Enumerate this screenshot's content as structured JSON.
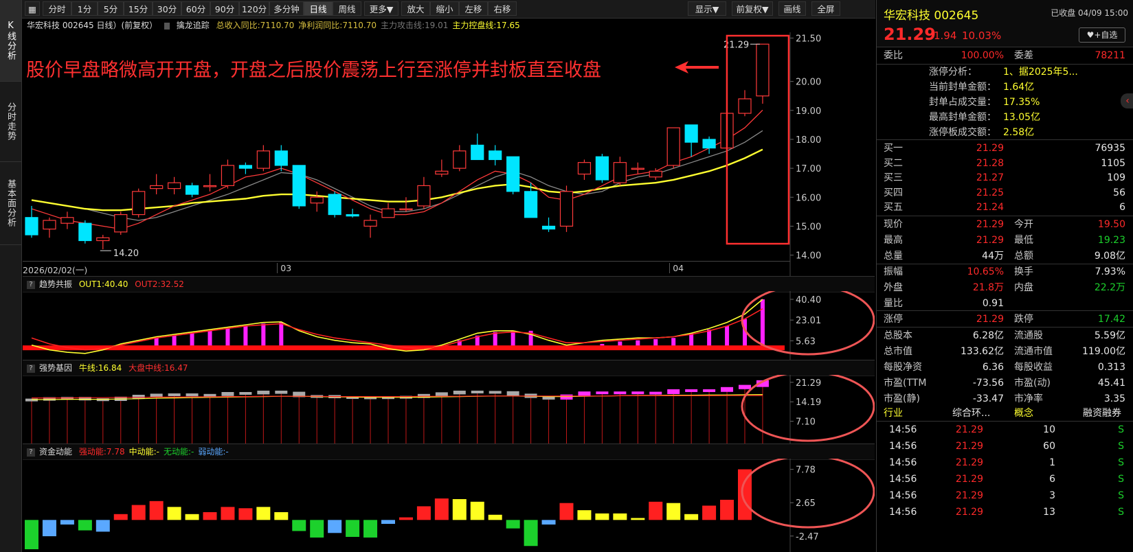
{
  "leftnav": [
    {
      "label": "K线分析",
      "active": true
    },
    {
      "label": "分时走势",
      "active": false
    },
    {
      "label": "基本面分析",
      "active": false
    }
  ],
  "toolbar": {
    "left": [
      "分时",
      "1分",
      "5分",
      "15分",
      "30分",
      "60分",
      "90分",
      "120分",
      "多分钟",
      "日线",
      "周线",
      "更多▼",
      "放大",
      "缩小",
      "左移",
      "右移"
    ],
    "active": "日线",
    "right": [
      "显示▼",
      "前复权▼",
      "画线",
      "全屏"
    ]
  },
  "main_header": {
    "title": "华宏科技 002645 日线）(前复权）",
    "indicator": "擒龙追踪",
    "items": [
      {
        "text": "总收入同比:7110.70",
        "color": "#d8c040"
      },
      {
        "text": "净利润同比:7110.70",
        "color": "#d8c040"
      },
      {
        "text": "主力攻击线:19.01",
        "color": "#777777"
      },
      {
        "text": "主力控盘线:17.65",
        "color": "#ffff30"
      }
    ]
  },
  "annotation": "股价早盘略微高开开盘，开盘之后股价震荡上行至涨停并封板直至收盘",
  "chart_data": [
    {
      "type": "candlestick",
      "title": "华宏科技 002645 日线",
      "ylim": [
        13.8,
        21.7
      ],
      "yticks": [
        "21.50",
        "20.00",
        "19.00",
        "18.00",
        "17.00",
        "16.00",
        "15.00",
        "14.00"
      ],
      "ytick_values": [
        21.5,
        20.0,
        19.0,
        18.0,
        17.0,
        16.0,
        15.0,
        14.0
      ],
      "xlabels": [
        {
          "i": 0,
          "label": "2026/02/02(一)"
        },
        {
          "i": 14,
          "label": "03"
        },
        {
          "i": 36,
          "label": "04"
        }
      ],
      "max_label": "21.29",
      "min_label": "14.20",
      "candles": [
        {
          "o": 15.3,
          "h": 15.7,
          "l": 14.6,
          "c": 14.7
        },
        {
          "o": 14.9,
          "h": 15.3,
          "l": 14.6,
          "c": 15.2
        },
        {
          "o": 15.1,
          "h": 15.5,
          "l": 14.9,
          "c": 15.3
        },
        {
          "o": 15.1,
          "h": 15.2,
          "l": 14.4,
          "c": 14.5
        },
        {
          "o": 14.5,
          "h": 14.7,
          "l": 14.2,
          "c": 14.6
        },
        {
          "o": 14.8,
          "h": 15.5,
          "l": 14.7,
          "c": 15.4
        },
        {
          "o": 15.4,
          "h": 16.3,
          "l": 15.3,
          "c": 16.2
        },
        {
          "o": 16.3,
          "h": 16.8,
          "l": 16.1,
          "c": 16.4
        },
        {
          "o": 16.3,
          "h": 16.7,
          "l": 16.1,
          "c": 16.5
        },
        {
          "o": 16.4,
          "h": 16.5,
          "l": 16.0,
          "c": 16.1
        },
        {
          "o": 16.4,
          "h": 16.8,
          "l": 16.2,
          "c": 16.4
        },
        {
          "o": 16.4,
          "h": 17.3,
          "l": 16.3,
          "c": 17.1
        },
        {
          "o": 17.1,
          "h": 17.2,
          "l": 16.8,
          "c": 17.0
        },
        {
          "o": 17.0,
          "h": 17.8,
          "l": 16.9,
          "c": 17.6
        },
        {
          "o": 17.6,
          "h": 17.8,
          "l": 16.9,
          "c": 17.1
        },
        {
          "o": 17.1,
          "h": 17.1,
          "l": 15.6,
          "c": 15.7
        },
        {
          "o": 15.8,
          "h": 16.2,
          "l": 15.5,
          "c": 16.0
        },
        {
          "o": 16.1,
          "h": 16.2,
          "l": 15.3,
          "c": 15.4
        },
        {
          "o": 15.4,
          "h": 15.6,
          "l": 15.3,
          "c": 15.35
        },
        {
          "o": 15.0,
          "h": 15.4,
          "l": 14.6,
          "c": 15.2
        },
        {
          "o": 15.3,
          "h": 15.8,
          "l": 15.3,
          "c": 15.6
        },
        {
          "o": 15.6,
          "h": 16.0,
          "l": 15.5,
          "c": 15.6
        },
        {
          "o": 15.7,
          "h": 16.7,
          "l": 15.6,
          "c": 16.4
        },
        {
          "o": 16.8,
          "h": 17.3,
          "l": 16.7,
          "c": 16.9
        },
        {
          "o": 17.0,
          "h": 17.8,
          "l": 16.9,
          "c": 17.6
        },
        {
          "o": 17.8,
          "h": 18.2,
          "l": 17.3,
          "c": 17.3
        },
        {
          "o": 17.6,
          "h": 17.8,
          "l": 17.1,
          "c": 17.3
        },
        {
          "o": 17.4,
          "h": 17.4,
          "l": 16.1,
          "c": 16.2
        },
        {
          "o": 16.2,
          "h": 16.5,
          "l": 15.3,
          "c": 15.3
        },
        {
          "o": 15.0,
          "h": 15.3,
          "l": 14.8,
          "c": 14.9
        },
        {
          "o": 15.0,
          "h": 16.4,
          "l": 14.8,
          "c": 16.2
        },
        {
          "o": 16.8,
          "h": 17.3,
          "l": 16.6,
          "c": 17.2
        },
        {
          "o": 17.4,
          "h": 17.5,
          "l": 16.5,
          "c": 16.6
        },
        {
          "o": 16.5,
          "h": 17.4,
          "l": 16.4,
          "c": 17.2
        },
        {
          "o": 17.0,
          "h": 17.2,
          "l": 16.8,
          "c": 17.0
        },
        {
          "o": 16.7,
          "h": 17.0,
          "l": 16.6,
          "c": 16.9
        },
        {
          "o": 17.1,
          "h": 18.4,
          "l": 17.0,
          "c": 18.4
        },
        {
          "o": 18.5,
          "h": 18.5,
          "l": 17.4,
          "c": 17.9
        },
        {
          "o": 18.0,
          "h": 18.1,
          "l": 17.5,
          "c": 17.7
        },
        {
          "o": 17.7,
          "h": 19.2,
          "l": 17.7,
          "c": 18.9
        },
        {
          "o": 18.9,
          "h": 19.7,
          "l": 18.8,
          "c": 19.4
        },
        {
          "o": 19.5,
          "h": 21.29,
          "l": 19.23,
          "c": 21.29
        }
      ],
      "series": [
        {
          "name": "主力攻击线",
          "color": "#ff3a3a",
          "values": [
            15.6,
            15.4,
            15.2,
            15.1,
            15.0,
            14.9,
            15.1,
            15.4,
            15.7,
            15.9,
            16.1,
            16.4,
            16.7,
            16.8,
            17.0,
            16.8,
            16.5,
            16.2,
            15.9,
            15.6,
            15.4,
            15.4,
            15.5,
            15.8,
            16.2,
            16.6,
            16.9,
            16.8,
            16.5,
            16.0,
            15.9,
            16.1,
            16.4,
            16.7,
            16.8,
            16.9,
            17.2,
            17.4,
            17.7,
            18.0,
            18.4,
            19.01
          ]
        },
        {
          "name": "主力控盘线",
          "color": "#ffff30",
          "values": [
            15.9,
            15.8,
            15.7,
            15.6,
            15.55,
            15.55,
            15.6,
            15.65,
            15.7,
            15.8,
            15.85,
            15.9,
            15.95,
            16.05,
            16.1,
            16.1,
            16.05,
            16.0,
            15.95,
            15.9,
            15.85,
            15.85,
            15.9,
            16.0,
            16.15,
            16.3,
            16.4,
            16.45,
            16.35,
            16.2,
            16.15,
            16.2,
            16.3,
            16.4,
            16.45,
            16.5,
            16.6,
            16.75,
            16.9,
            17.1,
            17.35,
            17.65
          ]
        },
        {
          "name": "",
          "color": "#8a8a8a",
          "values": [
            15.9,
            15.8,
            15.7,
            15.6,
            15.45,
            15.3,
            15.2,
            15.3,
            15.5,
            15.7,
            15.9,
            16.1,
            16.35,
            16.6,
            16.85,
            16.8,
            16.6,
            16.3,
            16.0,
            15.7,
            15.5,
            15.5,
            15.6,
            15.8,
            16.1,
            16.4,
            16.7,
            16.9,
            16.7,
            16.4,
            16.2,
            16.1,
            16.2,
            16.5,
            16.7,
            16.8,
            17.0,
            17.2,
            17.4,
            17.6,
            17.9,
            18.3
          ]
        }
      ]
    },
    {
      "type": "bar",
      "title": "趋势共振",
      "header": [
        "OUT1:40.40",
        "OUT2:32.52"
      ],
      "yticks": [
        "40.40",
        "23.01",
        "5.63"
      ],
      "ylim": [
        -8,
        45
      ],
      "values": [
        0,
        0,
        0,
        0,
        0,
        0,
        0,
        8,
        10,
        12,
        14,
        16,
        18,
        20,
        21,
        0,
        0,
        0,
        0,
        0,
        0,
        0,
        0,
        0,
        6,
        10,
        13,
        14,
        14,
        0,
        0,
        0,
        3,
        5,
        6,
        7,
        8,
        12,
        15,
        18,
        24,
        40.4
      ],
      "series": [
        {
          "name": "OUT1",
          "color": "#ffff30",
          "values": [
            2,
            -2,
            -4,
            -5,
            -2,
            3,
            6,
            9,
            11,
            13,
            15,
            17,
            19,
            21,
            21.5,
            14,
            9,
            6,
            4,
            3,
            -1,
            -3,
            -2,
            2,
            7,
            12,
            14,
            14,
            11,
            6,
            2,
            4,
            6,
            7,
            8,
            8,
            9,
            12,
            16,
            21,
            28,
            40.4
          ]
        },
        {
          "name": "OUT2",
          "color": "#ff2222",
          "values": [
            8,
            3,
            0,
            -2,
            -1,
            2,
            5,
            8,
            10,
            12,
            14,
            16,
            18,
            19,
            20,
            15,
            11,
            8,
            6,
            4,
            2,
            0,
            -1,
            1,
            5,
            9,
            12,
            13,
            12,
            8,
            4,
            4,
            5,
            6,
            7,
            8,
            9,
            11,
            14,
            18,
            24,
            32.52
          ]
        }
      ]
    },
    {
      "type": "bar",
      "title": "强势基因",
      "header": [
        "牛线:16.84",
        "大盘中线:16.47"
      ],
      "yticks": [
        "21.29",
        "14.19",
        "7.10"
      ],
      "ylim": [
        0,
        23
      ],
      "values": [
        14.6,
        15.1,
        15.2,
        14.7,
        14.5,
        15.3,
        16.0,
        16.4,
        16.5,
        16.2,
        16.3,
        17.0,
        16.9,
        17.5,
        17.1,
        15.9,
        15.9,
        15.5,
        15.4,
        15.2,
        15.5,
        15.6,
        16.3,
        16.9,
        17.5,
        17.4,
        17.3,
        16.4,
        15.6,
        15.0,
        16.1,
        17.2,
        17.0,
        17.2,
        17.1,
        17.0,
        18.0,
        18.0,
        17.8,
        18.8,
        19.6,
        21.29
      ],
      "series": [
        {
          "name": "牛线",
          "color": "#ffff30",
          "values": [
            15.0,
            15.0,
            15.1,
            15.1,
            15.1,
            15.2,
            15.3,
            15.5,
            15.6,
            15.7,
            15.8,
            15.9,
            16.0,
            16.1,
            16.2,
            16.2,
            16.1,
            16.0,
            15.9,
            15.8,
            15.8,
            15.8,
            15.9,
            16.0,
            16.1,
            16.2,
            16.3,
            16.3,
            16.2,
            16.1,
            16.1,
            16.2,
            16.3,
            16.4,
            16.5,
            16.5,
            16.6,
            16.6,
            16.7,
            16.7,
            16.8,
            16.84
          ]
        },
        {
          "name": "大盘中线",
          "color": "#ff2222",
          "values": [
            15.6,
            15.6,
            15.6,
            15.7,
            15.7,
            15.8,
            15.8,
            15.9,
            15.9,
            16.0,
            16.0,
            16.1,
            16.1,
            16.2,
            16.2,
            16.2,
            16.2,
            16.1,
            16.1,
            16.1,
            16.1,
            16.1,
            16.2,
            16.2,
            16.2,
            16.3,
            16.3,
            16.3,
            16.3,
            16.3,
            16.3,
            16.3,
            16.3,
            16.4,
            16.4,
            16.4,
            16.4,
            16.4,
            16.4,
            16.45,
            16.45,
            16.47
          ]
        }
      ]
    },
    {
      "type": "bar",
      "title": "资金动能",
      "header": [
        {
          "text": "强动能:7.78",
          "color": "#ff2a2a"
        },
        {
          "text": "中动能:-",
          "color": "#ffff30"
        },
        {
          "text": "无动能:-",
          "color": "#1cd12c"
        },
        {
          "text": "弱动能:-",
          "color": "#5aa8ff"
        }
      ],
      "yticks": [
        "7.78",
        "2.65",
        "-2.47"
      ],
      "ylim": [
        -4.5,
        9
      ],
      "values": [
        -4.5,
        -2.5,
        -0.7,
        -1.6,
        -1.8,
        0.9,
        2.3,
        2.9,
        2.0,
        0.9,
        1.2,
        2.0,
        1.8,
        2.0,
        1.2,
        -1.7,
        -2.7,
        -2.0,
        -2.6,
        -2.7,
        -0.6,
        0.4,
        2.1,
        3.3,
        3.2,
        2.8,
        0.8,
        -1.3,
        -4.0,
        -0.7,
        2.6,
        1.5,
        1.0,
        1.0,
        0.3,
        2.8,
        2.6,
        0.9,
        2.2,
        3.1,
        7.78
      ],
      "colors": [
        "#1cd12c",
        "#5aa8ff",
        "#5aa8ff",
        "#1cd12c",
        "#5aa8ff",
        "#ff2020",
        "#ff2020",
        "#ff2020",
        "#ffff20",
        "#ffff20",
        "#ff2020",
        "#ff2020",
        "#ff2020",
        "#ffff20",
        "#ffff20",
        "#1cd12c",
        "#1cd12c",
        "#5aa8ff",
        "#1cd12c",
        "#1cd12c",
        "#5aa8ff",
        "#ff2020",
        "#ff2020",
        "#ff2020",
        "#ffff20",
        "#ffff20",
        "#ffff20",
        "#1cd12c",
        "#1cd12c",
        "#5aa8ff",
        "#ff2020",
        "#ffff20",
        "#ffff20",
        "#ffff20",
        "#ffff20",
        "#ff2020",
        "#ffff20",
        "#ffff20",
        "#ff2020",
        "#ff2020",
        "#ff2020"
      ]
    }
  ],
  "right_panel": {
    "name_code": "华宏科技 002645",
    "status": "已收盘 04/09 15:00",
    "price": "21.29",
    "change": "1.94",
    "change_pct": "10.03%",
    "watch_button": "♥+自选",
    "ratio": {
      "label1": "委比",
      "val1": "100.00%",
      "label2": "委差",
      "val2": "78211"
    },
    "limit_info": [
      {
        "label": "涨停分析：",
        "value": "1、据2025年5..."
      },
      {
        "label": "当前封单金额：",
        "value": "1.64亿"
      },
      {
        "label": "封单占成交量：",
        "value": "17.35%"
      },
      {
        "label": "最高封单金额：",
        "value": "13.05亿"
      },
      {
        "label": "涨停板成交额：",
        "value": "2.58亿"
      }
    ],
    "bids": [
      {
        "label": "买一",
        "price": "21.29",
        "vol": "76935"
      },
      {
        "label": "买二",
        "price": "21.28",
        "vol": "1105"
      },
      {
        "label": "买三",
        "price": "21.27",
        "vol": "109"
      },
      {
        "label": "买四",
        "price": "21.25",
        "vol": "56"
      },
      {
        "label": "买五",
        "price": "21.24",
        "vol": "6"
      }
    ],
    "quotes": [
      [
        {
          "l": "现价",
          "v": "21.29",
          "c": "red"
        },
        {
          "l": "今开",
          "v": "19.50",
          "c": "red"
        }
      ],
      [
        {
          "l": "最高",
          "v": "21.29",
          "c": "red"
        },
        {
          "l": "最低",
          "v": "19.23",
          "c": "green"
        }
      ],
      [
        {
          "l": "总量",
          "v": "44万",
          "c": "white"
        },
        {
          "l": "总额",
          "v": "9.08亿",
          "c": "white"
        }
      ]
    ],
    "quotes2": [
      [
        {
          "l": "振幅",
          "v": "10.65%",
          "c": "red"
        },
        {
          "l": "换手",
          "v": "7.93%",
          "c": "white"
        }
      ],
      [
        {
          "l": "外盘",
          "v": "21.8万",
          "c": "red"
        },
        {
          "l": "内盘",
          "v": "22.2万",
          "c": "green"
        }
      ],
      [
        {
          "l": "量比",
          "v": "0.91",
          "c": "white"
        },
        {
          "l": "",
          "v": "",
          "c": "white"
        }
      ]
    ],
    "limits": [
      {
        "l": "涨停",
        "v": "21.29",
        "c": "red"
      },
      {
        "l": "跌停",
        "v": "17.42",
        "c": "green"
      }
    ],
    "fundamentals": [
      [
        {
          "l": "总股本",
          "v": "6.28亿"
        },
        {
          "l": "流通股",
          "v": "5.59亿"
        }
      ],
      [
        {
          "l": "总市值",
          "v": "133.62亿"
        },
        {
          "l": "流通市值",
          "v": "119.00亿"
        }
      ],
      [
        {
          "l": "每股净资",
          "v": "6.36"
        },
        {
          "l": "每股收益",
          "v": "0.313"
        }
      ],
      [
        {
          "l": "市盈(TTM",
          "v": "-73.56"
        },
        {
          "l": "市盈(动)",
          "v": "45.41"
        }
      ],
      [
        {
          "l": "市盈(静)",
          "v": "-33.47"
        },
        {
          "l": "市净率",
          "v": "3.35"
        }
      ]
    ],
    "tags": [
      {
        "text": "行业",
        "c": "yellow"
      },
      {
        "text": "综合环...",
        "c": "white"
      },
      {
        "text": "概念",
        "c": "yellow"
      },
      {
        "text": "融资融券",
        "c": "white"
      }
    ],
    "ticks": [
      {
        "t": "14:56",
        "p": "21.29",
        "v": "10",
        "d": "S"
      },
      {
        "t": "14:56",
        "p": "21.29",
        "v": "60",
        "d": "S"
      },
      {
        "t": "14:56",
        "p": "21.29",
        "v": "1",
        "d": "S"
      },
      {
        "t": "14:56",
        "p": "21.29",
        "v": "6",
        "d": "S"
      },
      {
        "t": "14:56",
        "p": "21.29",
        "v": "3",
        "d": "S"
      },
      {
        "t": "14:56",
        "p": "21.29",
        "v": "13",
        "d": "S"
      }
    ]
  }
}
